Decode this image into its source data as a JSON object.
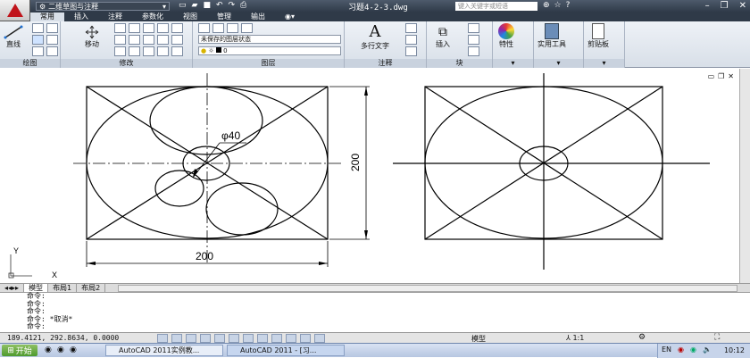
{
  "title_bar": {
    "workspace": "二维草图与注释",
    "document": "习题4-2-3.dwg",
    "search_placeholder": "键入关键字或短语"
  },
  "tabs": [
    "常用",
    "插入",
    "注释",
    "参数化",
    "视图",
    "管理",
    "输出"
  ],
  "ribbon": {
    "draw": {
      "line_label": "直线",
      "panel_label": "绘图"
    },
    "modify": {
      "move_label": "移动",
      "panel_label": "修改"
    },
    "layers": {
      "layer_state": "未保存的图层状态",
      "current_layer": "0",
      "panel_label": "图层"
    },
    "annotation": {
      "mtext_label": "多行文字",
      "panel_label": "注释"
    },
    "block": {
      "insert_label": "插入",
      "panel_label": "块"
    },
    "properties": {
      "label": "特性"
    },
    "utilities": {
      "label": "实用工具"
    },
    "clipboard": {
      "label": "剪贴板"
    }
  },
  "drawing": {
    "diameter_text": "φ40",
    "dim_horizontal": "200",
    "dim_vertical": "200",
    "ucs_y": "Y",
    "ucs_x": "X"
  },
  "layout_tabs": [
    "模型",
    "布局1",
    "布局2"
  ],
  "command_lines": [
    "命令:",
    "命令:",
    "命令:",
    "命令: *取消*",
    "命令:"
  ],
  "status": {
    "coordinates": "189.4121, 292.8634, 0.0000",
    "model_label": "模型",
    "scale": "1:1"
  },
  "taskbar": {
    "start": "开始",
    "items": [
      "AutoCAD 2011实例教...",
      "AutoCAD 2011 - [习..."
    ],
    "time": "10:12"
  },
  "colors": {
    "title_bg": "#2e3947",
    "ribbon_bg": "#d8dfe8",
    "accent": "#c0141b"
  }
}
